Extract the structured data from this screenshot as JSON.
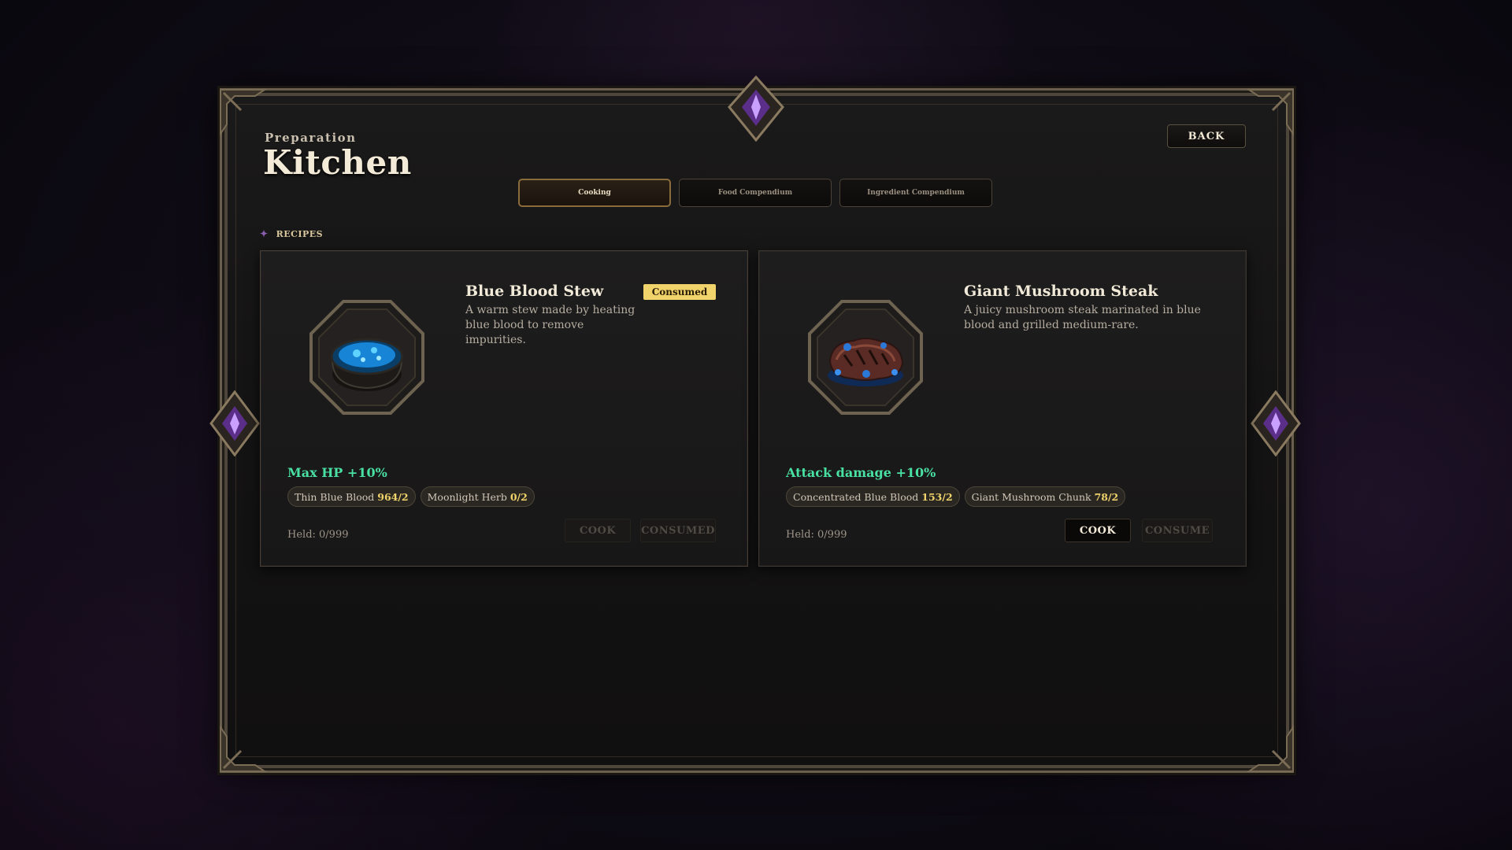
{
  "header": {
    "subtitle": "Preparation",
    "title": "Kitchen",
    "back_label": "BACK"
  },
  "tabs": [
    {
      "label": "Cooking",
      "active": true
    },
    {
      "label": "Food Compendium",
      "active": false
    },
    {
      "label": "Ingredient Compendium",
      "active": false
    }
  ],
  "section": {
    "label": "RECIPES"
  },
  "recipes": [
    {
      "name": "Blue Blood Stew",
      "description": "A warm stew made by heating blue blood to remove impurities.",
      "badge": "Consumed",
      "effect": "Max HP +10%",
      "ingredients": [
        {
          "name": "Thin Blue Blood",
          "qty": "964/2"
        },
        {
          "name": "Moonlight Herb",
          "qty": "0/2"
        }
      ],
      "held": "Held: 0/999",
      "cook_label": "COOK",
      "consume_label": "CONSUMED",
      "cook_enabled": false,
      "consume_enabled": false,
      "icon": "stew-pot-icon"
    },
    {
      "name": "Giant Mushroom Steak",
      "description": "A juicy mushroom steak marinated in blue blood and grilled medium-rare.",
      "effect": "Attack damage +10%",
      "ingredients": [
        {
          "name": "Concentrated Blue Blood",
          "qty": "153/2"
        },
        {
          "name": "Giant Mushroom Chunk",
          "qty": "78/2"
        }
      ],
      "held": "Held: 0/999",
      "cook_label": "COOK",
      "consume_label": "CONSUME",
      "cook_enabled": true,
      "consume_enabled": false,
      "icon": "mushroom-steak-icon"
    }
  ],
  "colors": {
    "effect": "#49e0a3",
    "badge": "#f0d36a",
    "qty": "#f0d36a",
    "gem": "#a070e0"
  }
}
